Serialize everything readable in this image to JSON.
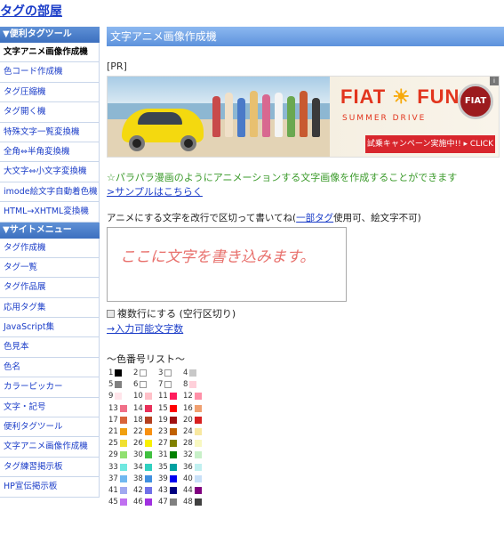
{
  "site_title": "タグの部屋",
  "sidebar": {
    "tools_header": "▼便利タグツール",
    "tools": [
      "文字アニメ画像作成機",
      "色コード作成機",
      "タグ圧縮機",
      "タグ開く機",
      "特殊文字一覧変換機",
      "全角⇔半角変換機",
      "大文字⇔小文字変換機",
      "imode絵文字自動着色機",
      "HTML→XHTML変換機"
    ],
    "site_header": "▼サイトメニュー",
    "menu": [
      "タグ作成機",
      "タグ一覧",
      "タグ作品展",
      "応用タグ集",
      "JavaScript集",
      "色見本",
      "色名",
      "カラーピッカー",
      "文字・記号",
      "便利タグツール",
      "文字アニメ画像作成機",
      "タグ練習掲示板",
      "HP宣伝掲示板"
    ]
  },
  "main": {
    "header": "文字アニメ画像作成機",
    "pr_label": "[PR]",
    "banner": {
      "brand": "FIAT",
      "brand2": "FUN",
      "sun": "☀",
      "subtitle": "SUMMER DRIVE",
      "cta": "試乗キャンペーン実施中!! ▸ CLICK",
      "logo": "FIAT",
      "info": "i"
    },
    "description": "☆パラパラ漫画のようにアニメーションする文字画像を作成することができます",
    "sample_link": ">サンプルはこちらく",
    "instruction_prefix": "アニメにする文字を改行で区切って書いてね(",
    "instruction_link": "一部タグ",
    "instruction_suffix": "使用可、絵文字不可)",
    "textarea_value": "ここに文字を書き込みます。",
    "multiline_label": "複数行にする (空行区切り)",
    "char_count_link": "→入力可能文字数",
    "color_list_title": "〜色番号リスト〜",
    "colors": [
      {
        "n": "1",
        "c": "#000000"
      },
      {
        "n": "2",
        "c": "#ffffff"
      },
      {
        "n": "3",
        "c": "#ffffff"
      },
      {
        "n": "4",
        "c": "#c8c8c8"
      },
      {
        "n": "5",
        "c": "#808080"
      },
      {
        "n": "6",
        "c": "#ffffff"
      },
      {
        "n": "7",
        "c": "#ffffff"
      },
      {
        "n": "8",
        "c": "#ffd0da"
      },
      {
        "n": "9",
        "c": "#ffe4ea"
      },
      {
        "n": "10",
        "c": "#ffc0c8"
      },
      {
        "n": "11",
        "c": "#ff1c5c"
      },
      {
        "n": "12",
        "c": "#ff90a8"
      },
      {
        "n": "13",
        "c": "#f07088"
      },
      {
        "n": "14",
        "c": "#e8305a"
      },
      {
        "n": "15",
        "c": "#ff0000"
      },
      {
        "n": "16",
        "c": "#f0a070"
      },
      {
        "n": "17",
        "c": "#d8643a"
      },
      {
        "n": "18",
        "c": "#b44020"
      },
      {
        "n": "19",
        "c": "#a01010"
      },
      {
        "n": "20",
        "c": "#d82020"
      },
      {
        "n": "21",
        "c": "#f0a010"
      },
      {
        "n": "22",
        "c": "#f89010"
      },
      {
        "n": "23",
        "c": "#c06000"
      },
      {
        "n": "24",
        "c": "#f8e8a0"
      },
      {
        "n": "25",
        "c": "#f0e030"
      },
      {
        "n": "26",
        "c": "#f8f000"
      },
      {
        "n": "27",
        "c": "#808000"
      },
      {
        "n": "28",
        "c": "#f8f8c0"
      },
      {
        "n": "29",
        "c": "#90e070"
      },
      {
        "n": "30",
        "c": "#40c040"
      },
      {
        "n": "31",
        "c": "#008000"
      },
      {
        "n": "32",
        "c": "#c8f0c8"
      },
      {
        "n": "33",
        "c": "#70e8e0"
      },
      {
        "n": "34",
        "c": "#30d0c0"
      },
      {
        "n": "35",
        "c": "#00a0a0"
      },
      {
        "n": "36",
        "c": "#c0f0f0"
      },
      {
        "n": "37",
        "c": "#70b8f0"
      },
      {
        "n": "38",
        "c": "#4090e0"
      },
      {
        "n": "39",
        "c": "#0000f0"
      },
      {
        "n": "40",
        "c": "#c8e0f8"
      },
      {
        "n": "41",
        "c": "#a0a8f0"
      },
      {
        "n": "42",
        "c": "#7070e8"
      },
      {
        "n": "43",
        "c": "#000080"
      },
      {
        "n": "44",
        "c": "#800080"
      },
      {
        "n": "45",
        "c": "#c070f0"
      },
      {
        "n": "46",
        "c": "#a030e0"
      },
      {
        "n": "47",
        "c": "#808080"
      },
      {
        "n": "48",
        "c": "#404040"
      }
    ]
  }
}
